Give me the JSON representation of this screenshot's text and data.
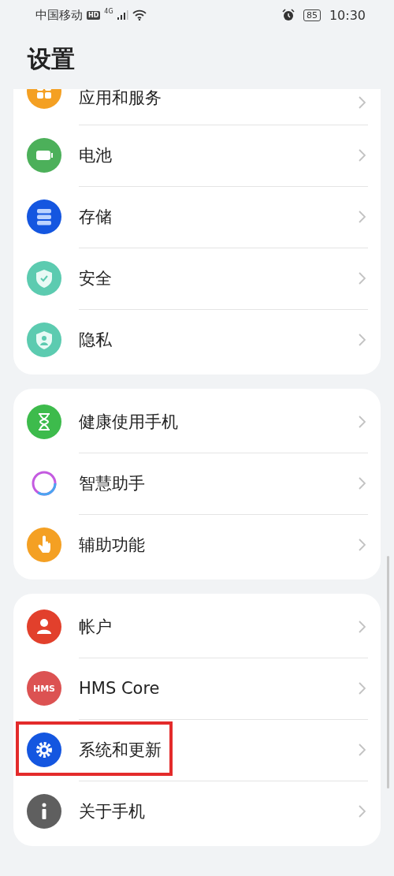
{
  "status_bar": {
    "carrier": "中国移动",
    "hd_badge": "HD",
    "network": "4G",
    "battery": "85",
    "time": "10:30"
  },
  "title": "设置",
  "sections": [
    {
      "items": [
        {
          "label": "应用和服务",
          "highlighted": false
        },
        {
          "label": "电池",
          "highlighted": false
        },
        {
          "label": "存储",
          "highlighted": false
        },
        {
          "label": "安全",
          "highlighted": false
        },
        {
          "label": "隐私",
          "highlighted": false
        }
      ]
    },
    {
      "items": [
        {
          "label": "健康使用手机",
          "highlighted": false
        },
        {
          "label": "智慧助手",
          "highlighted": false
        },
        {
          "label": "辅助功能",
          "highlighted": false
        }
      ]
    },
    {
      "items": [
        {
          "label": "帐户",
          "highlighted": false
        },
        {
          "label": "HMS Core",
          "icon_text": "HMS",
          "highlighted": false
        },
        {
          "label": "系统和更新",
          "highlighted": true
        },
        {
          "label": "关于手机",
          "highlighted": false
        }
      ]
    }
  ]
}
